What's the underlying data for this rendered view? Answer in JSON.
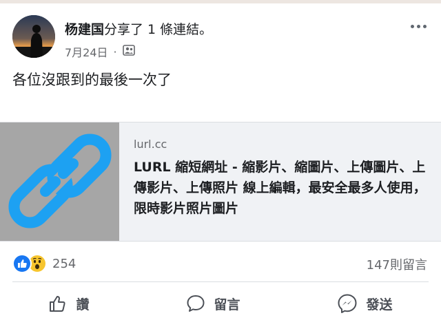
{
  "post": {
    "author": "杨建国",
    "action_text": "分享了 1 條連結。",
    "date": "7月24日",
    "separator": "·",
    "privacy_icon": "friends-icon",
    "text": "各位沒跟到的最後一次了"
  },
  "link": {
    "domain": "lurl.cc",
    "title": "LURL 縮短網址 - 縮影片、縮圖片、上傳圖片、上傳影片、上傳照片 線上編輯，最安全最多人使用，限時影片照片圖片",
    "thumb_icon": "chain-link-icon",
    "colors": {
      "thumb_bg": "#a6a6a6",
      "chain": "#1da1f2"
    }
  },
  "stats": {
    "reaction_icons": [
      "like-icon",
      "wow-icon"
    ],
    "reaction_count": "254",
    "comment_count": "147則留言"
  },
  "actions": {
    "like_label": "讚",
    "comment_label": "留言",
    "send_label": "發送"
  },
  "colors": {
    "accent": "#1877f2",
    "wow": "#f7c52e",
    "muted": "#65676b"
  }
}
